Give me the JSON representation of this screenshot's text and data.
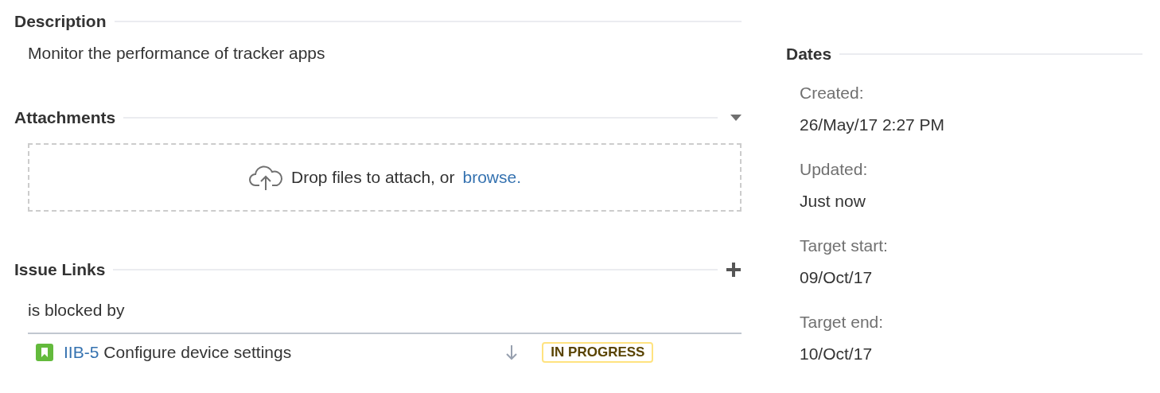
{
  "description": {
    "heading": "Description",
    "text": "Monitor the performance of tracker apps"
  },
  "attachments": {
    "heading": "Attachments",
    "drop_text": "Drop files to attach, or",
    "browse_link": "browse."
  },
  "issue_links": {
    "heading": "Issue Links",
    "groups": [
      {
        "relation": "is blocked by",
        "issues": [
          {
            "key": "IIB-5",
            "summary": "Configure device settings",
            "status": "IN PROGRESS"
          }
        ]
      }
    ]
  },
  "dates": {
    "heading": "Dates",
    "items": [
      {
        "label": "Created:",
        "value": "26/May/17 2:27 PM"
      },
      {
        "label": "Updated:",
        "value": "Just now"
      },
      {
        "label": "Target start:",
        "value": "09/Oct/17"
      },
      {
        "label": "Target end:",
        "value": "10/Oct/17"
      }
    ]
  }
}
